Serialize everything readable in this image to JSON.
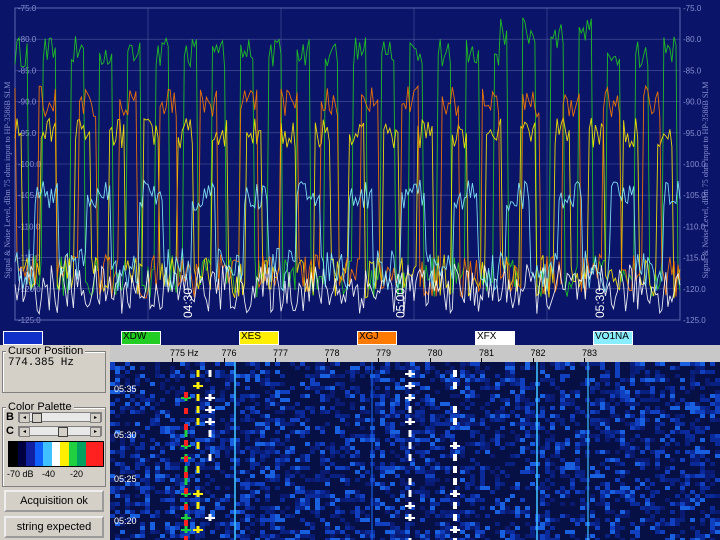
{
  "chart": {
    "ylabel": "Signal & Noise Level, dBm 75 ohm input to HP-3586B SLM",
    "y_ticks": [
      "-75.0",
      "-80.0",
      "-85.0",
      "-90.0",
      "-95.0",
      "-100.0",
      "-105.0",
      "-110.0",
      "-115.0",
      "-120.0",
      "-125.0"
    ],
    "time_labels": [
      "04:30",
      "05:00",
      "05:30"
    ],
    "colors": {
      "background": "#0a1468",
      "grid": "#5058a0"
    }
  },
  "chart_data": {
    "type": "line",
    "ylim": [
      -125,
      -75
    ],
    "x_time_labels": [
      "04:30",
      "05:00",
      "05:30"
    ],
    "series": [
      {
        "name": "XDW",
        "color": "#22cc22",
        "peak_dBm": -82,
        "noise_dBm": -118
      },
      {
        "name": "XES",
        "color": "#ffee00",
        "peak_dBm": -95,
        "noise_dBm": -118
      },
      {
        "name": "XGJ",
        "color": "#ff7a00",
        "peak_dBm": -90,
        "noise_dBm": -118
      },
      {
        "name": "XFX",
        "color": "#ffffff",
        "peak_dBm": -115,
        "noise_dBm": -120
      },
      {
        "name": "VO1NA",
        "color": "#88eeff",
        "peak_dBm": -105,
        "noise_dBm": -117
      }
    ]
  },
  "legend": [
    {
      "name": "",
      "color": "#1030c8"
    },
    {
      "name": "XDW",
      "color": "#22cc22"
    },
    {
      "name": "XES",
      "color": "#ffee00"
    },
    {
      "name": "XGJ",
      "color": "#ff7a00"
    },
    {
      "name": "XFX",
      "color": "#ffffff"
    },
    {
      "name": "VO1NA",
      "color": "#88eeff"
    }
  ],
  "cursor": {
    "title": "Cursor Position",
    "value": "774.385 Hz"
  },
  "palette": {
    "title": "Color Palette",
    "b_label": "B",
    "c_label": "C",
    "b_level": 0.05,
    "c_level": 0.5,
    "ticks": [
      "-70 dB",
      "-40",
      "-20"
    ]
  },
  "buttons": {
    "acquisition": "Acquisition ok",
    "string": "string expected"
  },
  "waterfall": {
    "freq_labels": [
      "775 Hz",
      "776",
      "777",
      "778",
      "779",
      "780",
      "781",
      "782",
      "783"
    ],
    "time_labels": [
      "05:35",
      "05:30",
      "05:25",
      "05:20"
    ]
  }
}
